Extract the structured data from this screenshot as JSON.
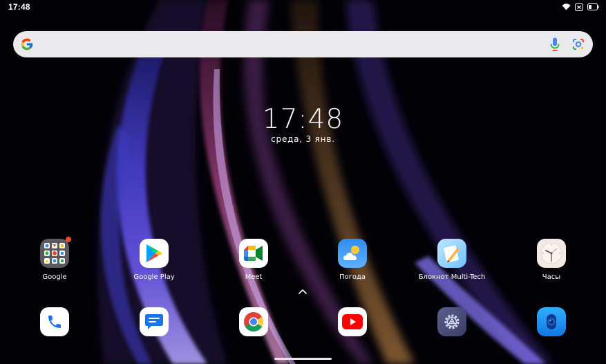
{
  "status_bar": {
    "time": "17:48",
    "icons": [
      "wifi-icon",
      "battery-saver-icon",
      "battery-icon"
    ]
  },
  "search": {
    "placeholder": "",
    "icons": [
      "google-g-icon",
      "mic-icon",
      "google-lens-icon"
    ]
  },
  "clock_widget": {
    "time": "17:48",
    "date": "среда, 3 янв."
  },
  "apps": [
    {
      "label": "Google",
      "icon": "google-folder-icon",
      "badge": true
    },
    {
      "label": "Google Play",
      "icon": "play-store-icon"
    },
    {
      "label": "Meet",
      "icon": "meet-icon"
    },
    {
      "label": "Погода",
      "icon": "weather-icon"
    },
    {
      "label": "Блокнот Multi-Tech",
      "icon": "notepad-icon"
    },
    {
      "label": "Часы",
      "icon": "clock-icon"
    }
  ],
  "dock": [
    {
      "icon": "phone-icon"
    },
    {
      "icon": "messages-icon"
    },
    {
      "icon": "chrome-icon"
    },
    {
      "icon": "youtube-icon"
    },
    {
      "icon": "settings-icon"
    },
    {
      "icon": "camera-icon"
    }
  ],
  "colors": {
    "search_bg": "#eaeaec",
    "badge": "#f04a2f",
    "weather_blue": "#2f8cf0",
    "youtube_red": "#ff0000"
  }
}
